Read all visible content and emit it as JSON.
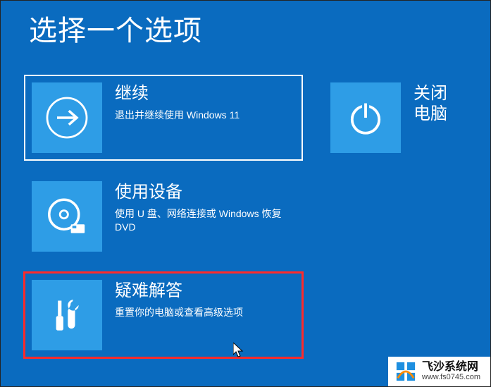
{
  "title": "选择一个选项",
  "tiles": {
    "continue": {
      "title": "继续",
      "desc": "退出并继续使用 Windows 11",
      "icon": "arrow-right-icon"
    },
    "shutdown": {
      "title": "关闭电脑",
      "icon": "power-icon"
    },
    "use_device": {
      "title": "使用设备",
      "desc": "使用 U 盘、网络连接或 Windows 恢复 DVD",
      "icon": "disc-icon"
    },
    "troubleshoot": {
      "title": "疑难解答",
      "desc": "重置你的电脑或查看高级选项",
      "icon": "tools-icon"
    }
  },
  "watermark": {
    "name": "飞沙系统网",
    "url": "www.fs0745.com"
  },
  "colors": {
    "bg": "#0a6bbf",
    "tile": "#2e9de6",
    "select": "#ffffff",
    "highlight": "#ff2a2a"
  }
}
